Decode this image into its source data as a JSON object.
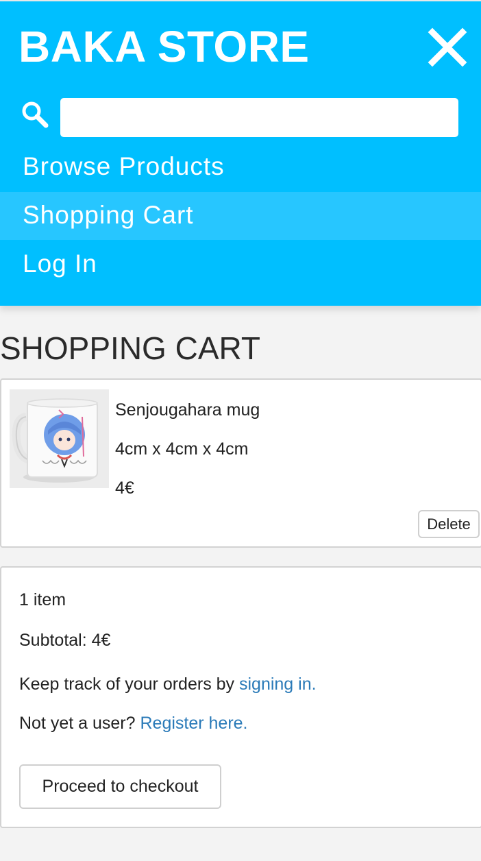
{
  "header": {
    "brand": "BAKA STORE",
    "bg_color": "#00bfff",
    "close_icon": "close-icon",
    "search_icon": "search-icon",
    "search": {
      "value": "",
      "placeholder": ""
    },
    "nav": [
      {
        "label": "Browse Products",
        "active": false
      },
      {
        "label": "Shopping Cart",
        "active": true
      },
      {
        "label": "Log In",
        "active": false
      }
    ]
  },
  "page": {
    "title": "SHOPPING CART"
  },
  "cart": {
    "items": [
      {
        "name": "Senjougahara mug",
        "dimensions": "4cm x 4cm x 4cm",
        "price": "4€",
        "delete_label": "Delete"
      }
    ]
  },
  "summary": {
    "count": "1 item",
    "subtotal": "Subtotal: 4€",
    "track_text": "Keep track of your orders by ",
    "track_link": "signing in.",
    "register_text": "Not yet a user? ",
    "register_link": "Register here.",
    "link_color": "#2a7ab8",
    "checkout_label": "Proceed to checkout"
  }
}
